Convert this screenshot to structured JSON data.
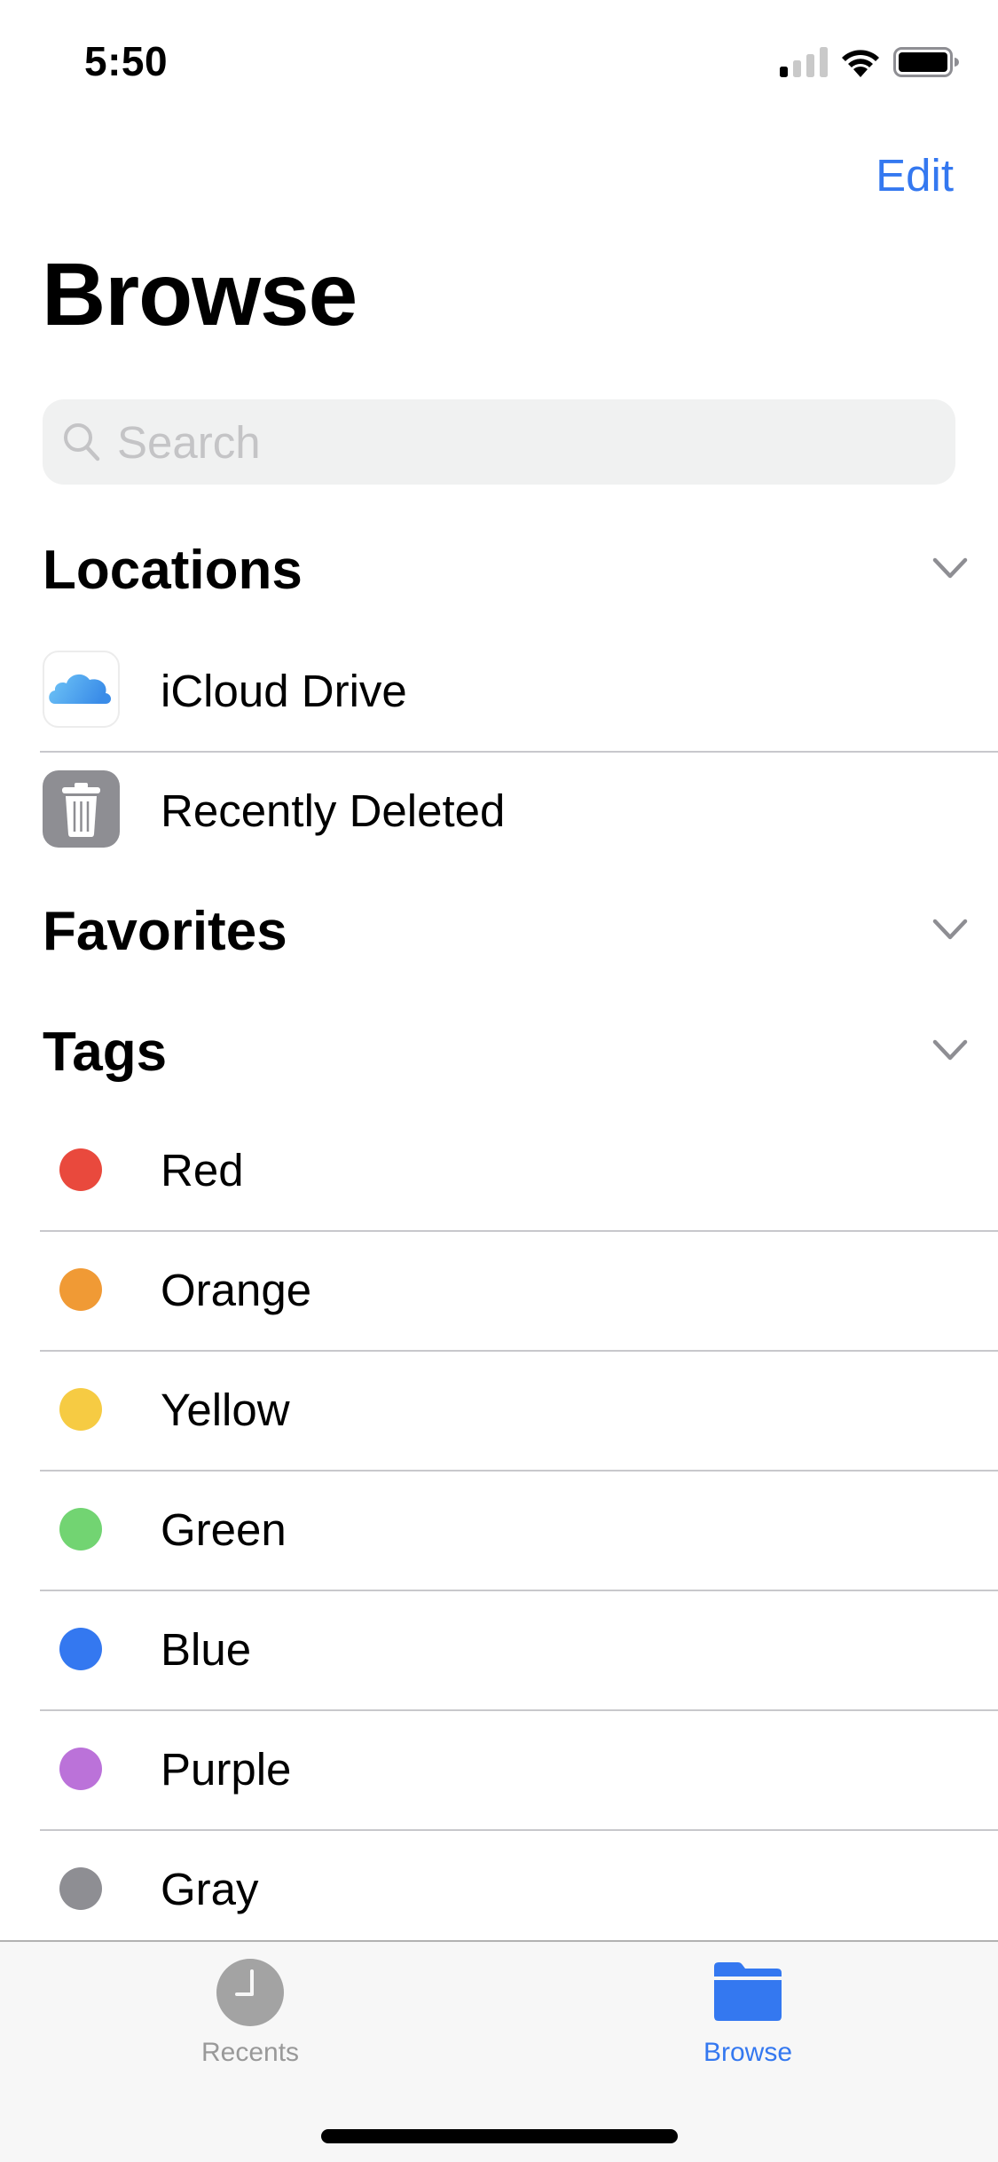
{
  "status_bar": {
    "time": "5:50",
    "signal_bars_active": 1,
    "signal_bars_total": 4,
    "wifi": "wifi-icon",
    "battery": "battery-icon"
  },
  "nav": {
    "edit_label": "Edit",
    "title": "Browse"
  },
  "search": {
    "placeholder": "Search",
    "value": "",
    "icon": "search-icon"
  },
  "sections": {
    "locations": {
      "title": "Locations",
      "items": [
        {
          "label": "iCloud Drive",
          "icon": "icloud-icon"
        },
        {
          "label": "Recently Deleted",
          "icon": "trash-icon"
        }
      ]
    },
    "favorites": {
      "title": "Favorites"
    },
    "tags": {
      "title": "Tags",
      "items": [
        {
          "label": "Red",
          "color": "#e9493d"
        },
        {
          "label": "Orange",
          "color": "#f09a35"
        },
        {
          "label": "Yellow",
          "color": "#f6cb43"
        },
        {
          "label": "Green",
          "color": "#72d472"
        },
        {
          "label": "Blue",
          "color": "#3478f0"
        },
        {
          "label": "Purple",
          "color": "#bb72d9"
        },
        {
          "label": "Gray",
          "color": "#8e8e93"
        }
      ]
    }
  },
  "tab_bar": {
    "tabs": [
      {
        "label": "Recents",
        "icon": "clock-icon",
        "selected": false
      },
      {
        "label": "Browse",
        "icon": "folder-icon",
        "selected": true
      }
    ]
  },
  "colors": {
    "accent": "#3478f0",
    "inactive_tab": "#999999",
    "separator": "#c8c8cc"
  }
}
